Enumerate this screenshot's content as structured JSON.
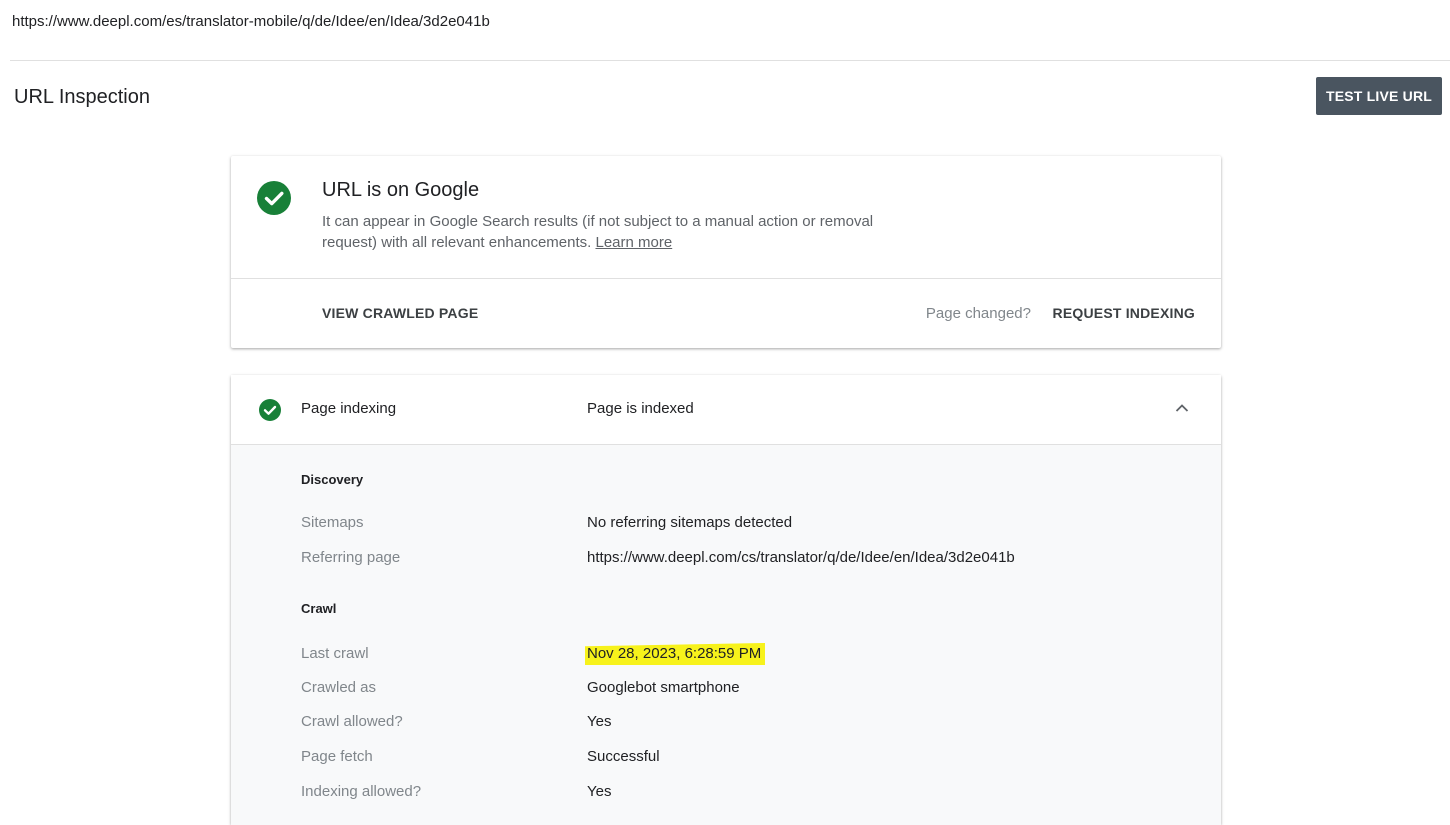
{
  "url": "https://www.deepl.com/es/translator-mobile/q/de/Idee/en/Idea/3d2e041b",
  "header": {
    "title": "URL Inspection",
    "test_live_url_label": "TEST LIVE URL"
  },
  "status": {
    "title": "URL is on Google",
    "description": "It can appear in Google Search results (if not subject to a manual action or removal request) with all relevant enhancements.",
    "learn_more_label": "Learn more",
    "view_crawled_page_label": "VIEW CRAWLED PAGE",
    "page_changed_label": "Page changed?",
    "request_indexing_label": "REQUEST INDEXING"
  },
  "page_indexing": {
    "label": "Page indexing",
    "value": "Page is indexed",
    "discovery": {
      "heading": "Discovery",
      "sitemaps_label": "Sitemaps",
      "sitemaps_value": "No referring sitemaps detected",
      "referring_page_label": "Referring page",
      "referring_page_value": "https://www.deepl.com/cs/translator/q/de/Idee/en/Idea/3d2e041b"
    },
    "crawl": {
      "heading": "Crawl",
      "last_crawl_label": "Last crawl",
      "last_crawl_value": "Nov 28, 2023, 6:28:59 PM",
      "crawled_as_label": "Crawled as",
      "crawled_as_value": "Googlebot smartphone",
      "crawl_allowed_label": "Crawl allowed?",
      "crawl_allowed_value": "Yes",
      "page_fetch_label": "Page fetch",
      "page_fetch_value": "Successful",
      "indexing_allowed_label": "Indexing allowed?",
      "indexing_allowed_value": "Yes"
    }
  },
  "colors": {
    "success_green": "#188038",
    "button_dark": "#4a5560",
    "highlight_yellow": "#f7f21b"
  },
  "icons": {
    "status": "check-circle-icon",
    "indexing": "check-circle-icon",
    "collapse": "chevron-up-icon"
  }
}
